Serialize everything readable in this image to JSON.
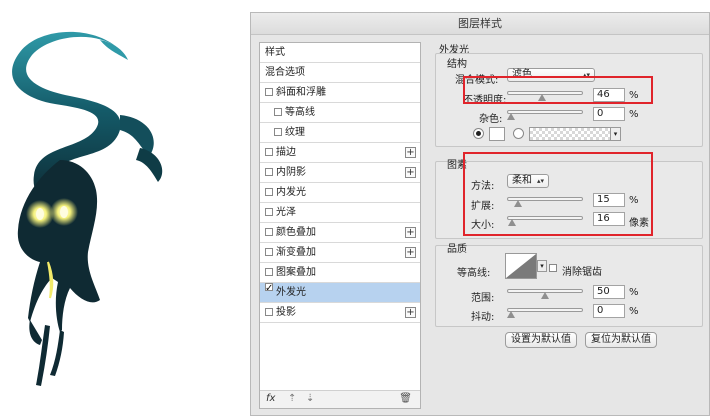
{
  "dialog": {
    "title": "图层样式"
  },
  "sidebar": {
    "items": [
      {
        "label": "样式",
        "checkbox": false,
        "checked": false,
        "indent": false,
        "plus": false,
        "selected": false
      },
      {
        "label": "混合选项",
        "checkbox": false,
        "checked": false,
        "indent": false,
        "plus": false,
        "selected": false
      },
      {
        "label": "斜面和浮雕",
        "checkbox": true,
        "checked": false,
        "indent": false,
        "plus": false,
        "selected": false
      },
      {
        "label": "等高线",
        "checkbox": true,
        "checked": false,
        "indent": true,
        "plus": false,
        "selected": false
      },
      {
        "label": "纹理",
        "checkbox": true,
        "checked": false,
        "indent": true,
        "plus": false,
        "selected": false
      },
      {
        "label": "描边",
        "checkbox": true,
        "checked": false,
        "indent": false,
        "plus": true,
        "selected": false
      },
      {
        "label": "内阴影",
        "checkbox": true,
        "checked": false,
        "indent": false,
        "plus": true,
        "selected": false
      },
      {
        "label": "内发光",
        "checkbox": true,
        "checked": false,
        "indent": false,
        "plus": false,
        "selected": false
      },
      {
        "label": "光泽",
        "checkbox": true,
        "checked": false,
        "indent": false,
        "plus": false,
        "selected": false
      },
      {
        "label": "颜色叠加",
        "checkbox": true,
        "checked": false,
        "indent": false,
        "plus": true,
        "selected": false
      },
      {
        "label": "渐变叠加",
        "checkbox": true,
        "checked": false,
        "indent": false,
        "plus": true,
        "selected": false
      },
      {
        "label": "图案叠加",
        "checkbox": true,
        "checked": false,
        "indent": false,
        "plus": false,
        "selected": false
      },
      {
        "label": "外发光",
        "checkbox": true,
        "checked": true,
        "indent": false,
        "plus": false,
        "selected": true
      },
      {
        "label": "投影",
        "checkbox": true,
        "checked": false,
        "indent": false,
        "plus": true,
        "selected": false
      }
    ],
    "bottom": {
      "fx": "fx",
      "up": "⇡",
      "down": "⇣",
      "trash": "🗑"
    }
  },
  "outer_glow": {
    "title": "外发光",
    "structure": {
      "title": "结构",
      "blend_mode_label": "混合模式:",
      "blend_mode_value": "滤色",
      "opacity_label": "不透明度:",
      "opacity_value": "46",
      "opacity_percent": 46,
      "opacity_unit": "%",
      "noise_label": "杂色:",
      "noise_value": "0",
      "noise_percent": 0,
      "noise_unit": "%"
    },
    "elements": {
      "title": "图素",
      "technique_label": "方法:",
      "technique_value": "柔和",
      "spread_label": "扩展:",
      "spread_value": "15",
      "spread_percent": 15,
      "spread_unit": "%",
      "size_label": "大小:",
      "size_value": "16",
      "size_fraction": 0.064,
      "size_unit": "像素"
    },
    "quality": {
      "title": "品质",
      "contour_label": "等高线:",
      "antialias_label": "消除锯齿",
      "range_label": "范围:",
      "range_value": "50",
      "range_percent": 50,
      "range_unit": "%",
      "jitter_label": "抖动:",
      "jitter_value": "0",
      "jitter_percent": 0,
      "jitter_unit": "%"
    },
    "buttons": {
      "make_default": "设置为默认值",
      "reset_default": "复位为默认值"
    }
  },
  "colors": {
    "accent_highlight": "#e0242b",
    "selected_row": "#b7d2ef",
    "character_dark": "#0f2a33",
    "character_teal": "#1f8a9a",
    "glow": "#f3f07a"
  }
}
